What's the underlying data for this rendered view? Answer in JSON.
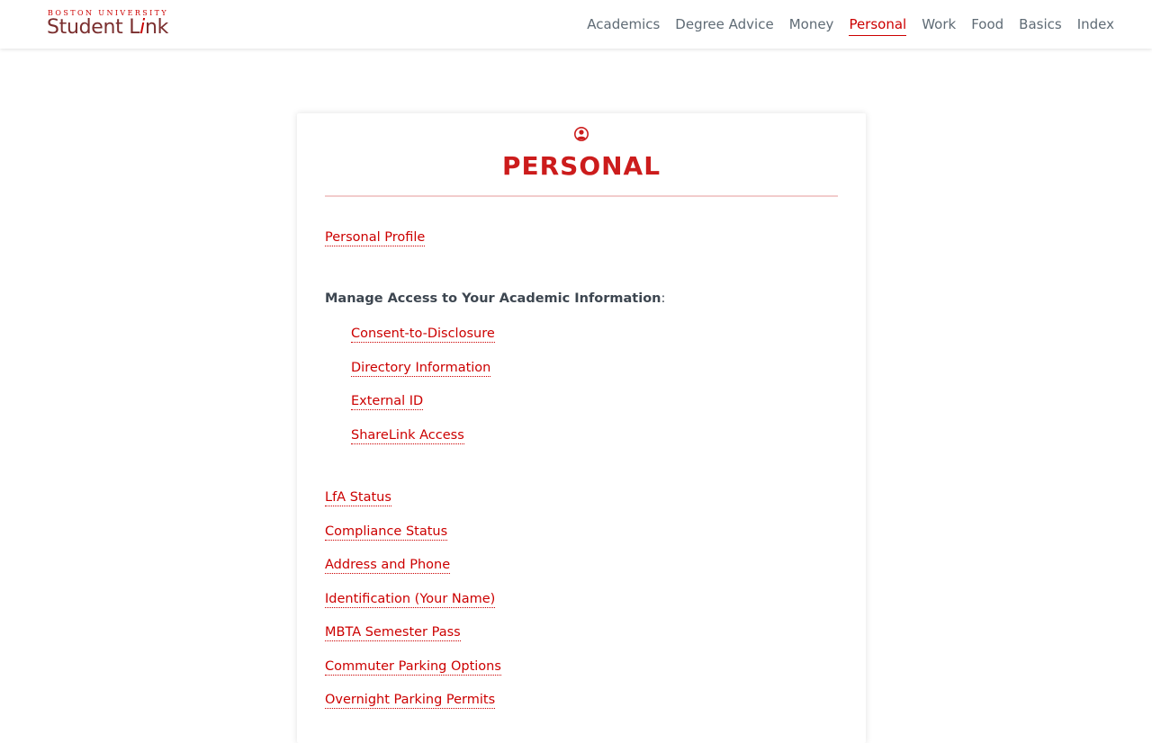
{
  "header": {
    "logo_top": "BOSTON UNIVERSITY",
    "logo_main_prefix": "Student L",
    "logo_main_i": "i",
    "logo_main_suffix": "nk",
    "nav": [
      {
        "label": "Academics",
        "active": false
      },
      {
        "label": "Degree Advice",
        "active": false
      },
      {
        "label": "Money",
        "active": false
      },
      {
        "label": "Personal",
        "active": true
      },
      {
        "label": "Work",
        "active": false
      },
      {
        "label": "Food",
        "active": false
      },
      {
        "label": "Basics",
        "active": false
      },
      {
        "label": "Index",
        "active": false
      }
    ]
  },
  "card": {
    "icon": "user-circle-icon",
    "title": "PERSONAL",
    "personal_profile": "Personal Profile",
    "section_label": "Manage Access to Your Academic Information",
    "section_colon": ":",
    "access_links": [
      "Consent-to-Disclosure",
      "Directory Information",
      "External ID",
      "ShareLink Access"
    ],
    "links": [
      "LfA Status",
      "Compliance Status",
      "Address and Phone",
      "Identification (Your Name)",
      "MBTA Semester Pass",
      "Commuter Parking Options",
      "Overnight Parking Permits"
    ]
  },
  "colors": {
    "accent": "#cc0000",
    "nav_text": "#5f6b75",
    "label_text": "#3d4650"
  }
}
